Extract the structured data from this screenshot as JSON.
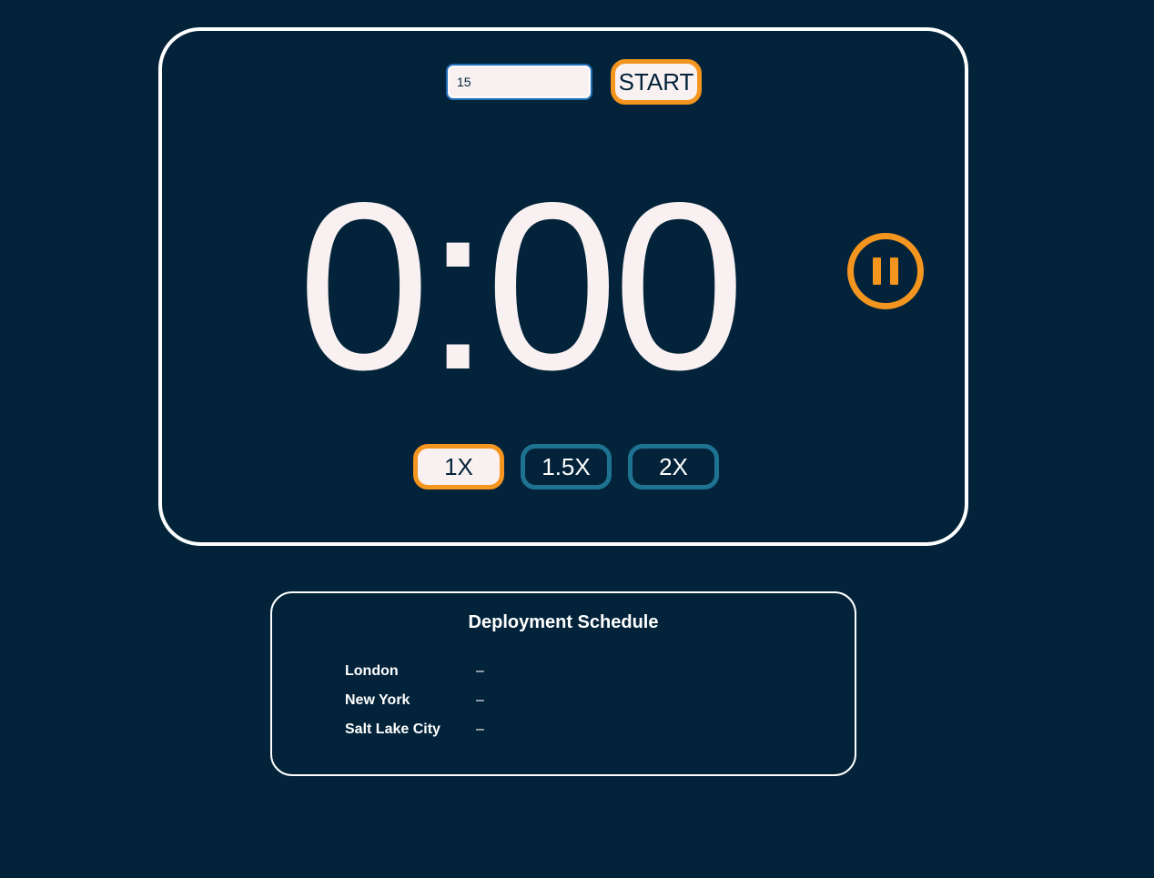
{
  "timer": {
    "minutes_input_value": "15",
    "start_label": "START",
    "time_display": "0:00",
    "pause_icon": "pause-icon",
    "speeds": [
      {
        "label": "1X",
        "active": true
      },
      {
        "label": "1.5X",
        "active": false
      },
      {
        "label": "2X",
        "active": false
      }
    ]
  },
  "schedule": {
    "title": "Deployment Schedule",
    "rows": [
      {
        "city": "London",
        "value": "–"
      },
      {
        "city": "New York",
        "value": "–"
      },
      {
        "city": "Salt Lake City",
        "value": "–"
      }
    ]
  },
  "colors": {
    "background": "#03233a",
    "accent": "#f4951f",
    "inactive_border": "#1e7391",
    "light": "#f9f1f1"
  }
}
